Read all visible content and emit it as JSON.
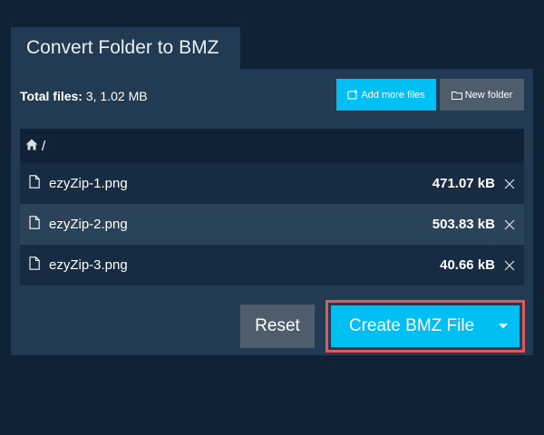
{
  "tab": {
    "title": "Convert Folder to BMZ"
  },
  "summary": {
    "label": "Total files:",
    "value": "3, 1.02 MB"
  },
  "toolbar": {
    "add_label": "Add more files",
    "add_icon": "add-file-icon",
    "folder_label": "New folder",
    "folder_icon": "folder-icon"
  },
  "path": {
    "text": "/",
    "icon": "home-icon"
  },
  "files": [
    {
      "name": "ezyZip-1.png",
      "size": "471.07 kB"
    },
    {
      "name": "ezyZip-2.png",
      "size": "503.83 kB"
    },
    {
      "name": "ezyZip-3.png",
      "size": "40.66 kB"
    }
  ],
  "actions": {
    "reset_label": "Reset",
    "create_label": "Create BMZ File"
  },
  "colors": {
    "background": "#0f2236",
    "panel": "#223a52",
    "accent": "#00bff3",
    "secondary": "#4e5d6c",
    "highlight_border": "#e0585a"
  }
}
